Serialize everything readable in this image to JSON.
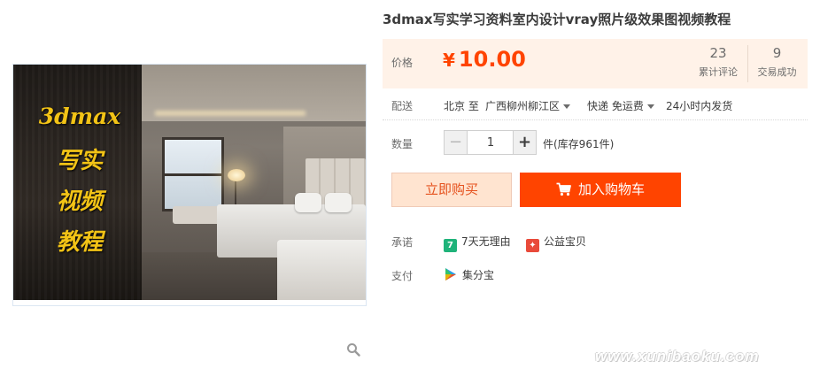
{
  "product": {
    "title": "3dmax写实学习资料室内设计vray照片级效果图视频教程"
  },
  "gallery": {
    "caption_lines": [
      "3dmax",
      "写实",
      "视频",
      "教程"
    ]
  },
  "price": {
    "label": "价格",
    "currency": "¥",
    "amount": "10.00",
    "color": "#ff4400",
    "stats": {
      "comments_count": "23",
      "comments_label": "累计评论",
      "deals_count": "9",
      "deals_label": "交易成功"
    }
  },
  "shipping": {
    "label": "配送",
    "from": "北京 至",
    "to": "广西柳州柳江区",
    "method": "快递 免运费",
    "dispatch": "24小时内发货"
  },
  "quantity": {
    "label": "数量",
    "value": "1",
    "minus": "−",
    "plus": "+",
    "stock_text": "件(库存961件)"
  },
  "actions": {
    "buy_now": "立即购买",
    "add_to_cart": "加入购物车",
    "cart_icon": "shopping-cart-icon"
  },
  "promise": {
    "label": "承诺",
    "items": [
      {
        "icon": "seven-day-return-icon",
        "badge": "7",
        "text": "7天无理由"
      },
      {
        "icon": "charity-gift-icon",
        "badge": "✦",
        "text": "公益宝贝"
      }
    ]
  },
  "payment": {
    "label": "支付",
    "icon": "jifenbao-icon",
    "text": "集分宝"
  },
  "watermark": {
    "text": "www.xunibaoku.com"
  }
}
